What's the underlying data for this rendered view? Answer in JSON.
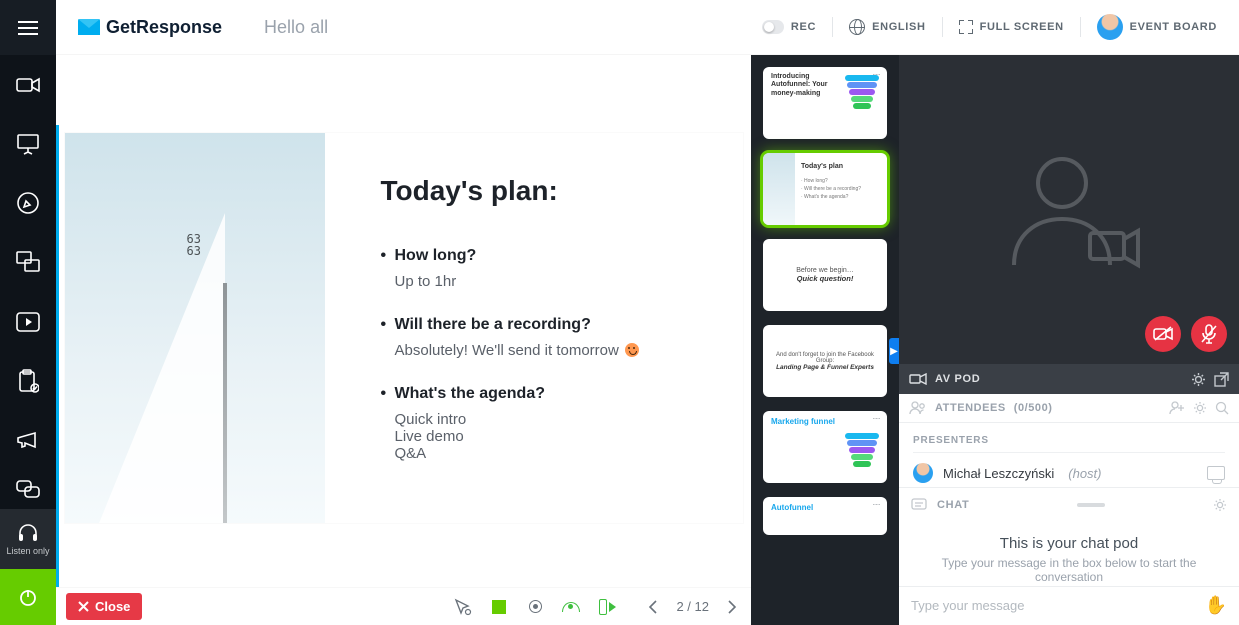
{
  "brand": "GetResponse",
  "greeting": "Hello all",
  "topbar": {
    "rec": "REC",
    "language": "ENGLISH",
    "fullscreen": "FULL SCREEN",
    "event_board": "EVENT BOARD"
  },
  "rail": {
    "listen_label": "Listen only"
  },
  "slide": {
    "title": "Today's plan:",
    "items": [
      {
        "q": "How long?",
        "a": "Up to 1hr"
      },
      {
        "q": "Will there be a recording?",
        "a": "Absolutely! We'll send it tomorrow"
      },
      {
        "q": "What's the agenda?",
        "a": "Quick intro\nLive demo\nQ&A"
      }
    ],
    "sail_number": "63\n63"
  },
  "footer": {
    "close": "Close",
    "page": "2 / 12"
  },
  "thumbnails": [
    {
      "title": "Introducing Autofunnel: Your money-making"
    },
    {
      "title": "Today's plan"
    },
    {
      "title_a": "Before we begin…",
      "title_b": "Quick question!"
    },
    {
      "title": "And don't forget to join the Facebook Group:",
      "sub": "Landing Page & Funnel Experts"
    },
    {
      "title": "Marketing funnel"
    },
    {
      "title": "Autofunnel"
    }
  ],
  "right": {
    "avpod": "AV POD",
    "attendees_label": "ATTENDEES",
    "attendees_count": "(0/500)",
    "presenters_header": "PRESENTERS",
    "presenter": {
      "name": "Michał Leszczyński",
      "role": "(host)"
    },
    "chat_label": "CHAT",
    "chat_title": "This is your chat pod",
    "chat_sub": "Type your message in the box below to start the conversation",
    "chat_placeholder": "Type your message"
  }
}
